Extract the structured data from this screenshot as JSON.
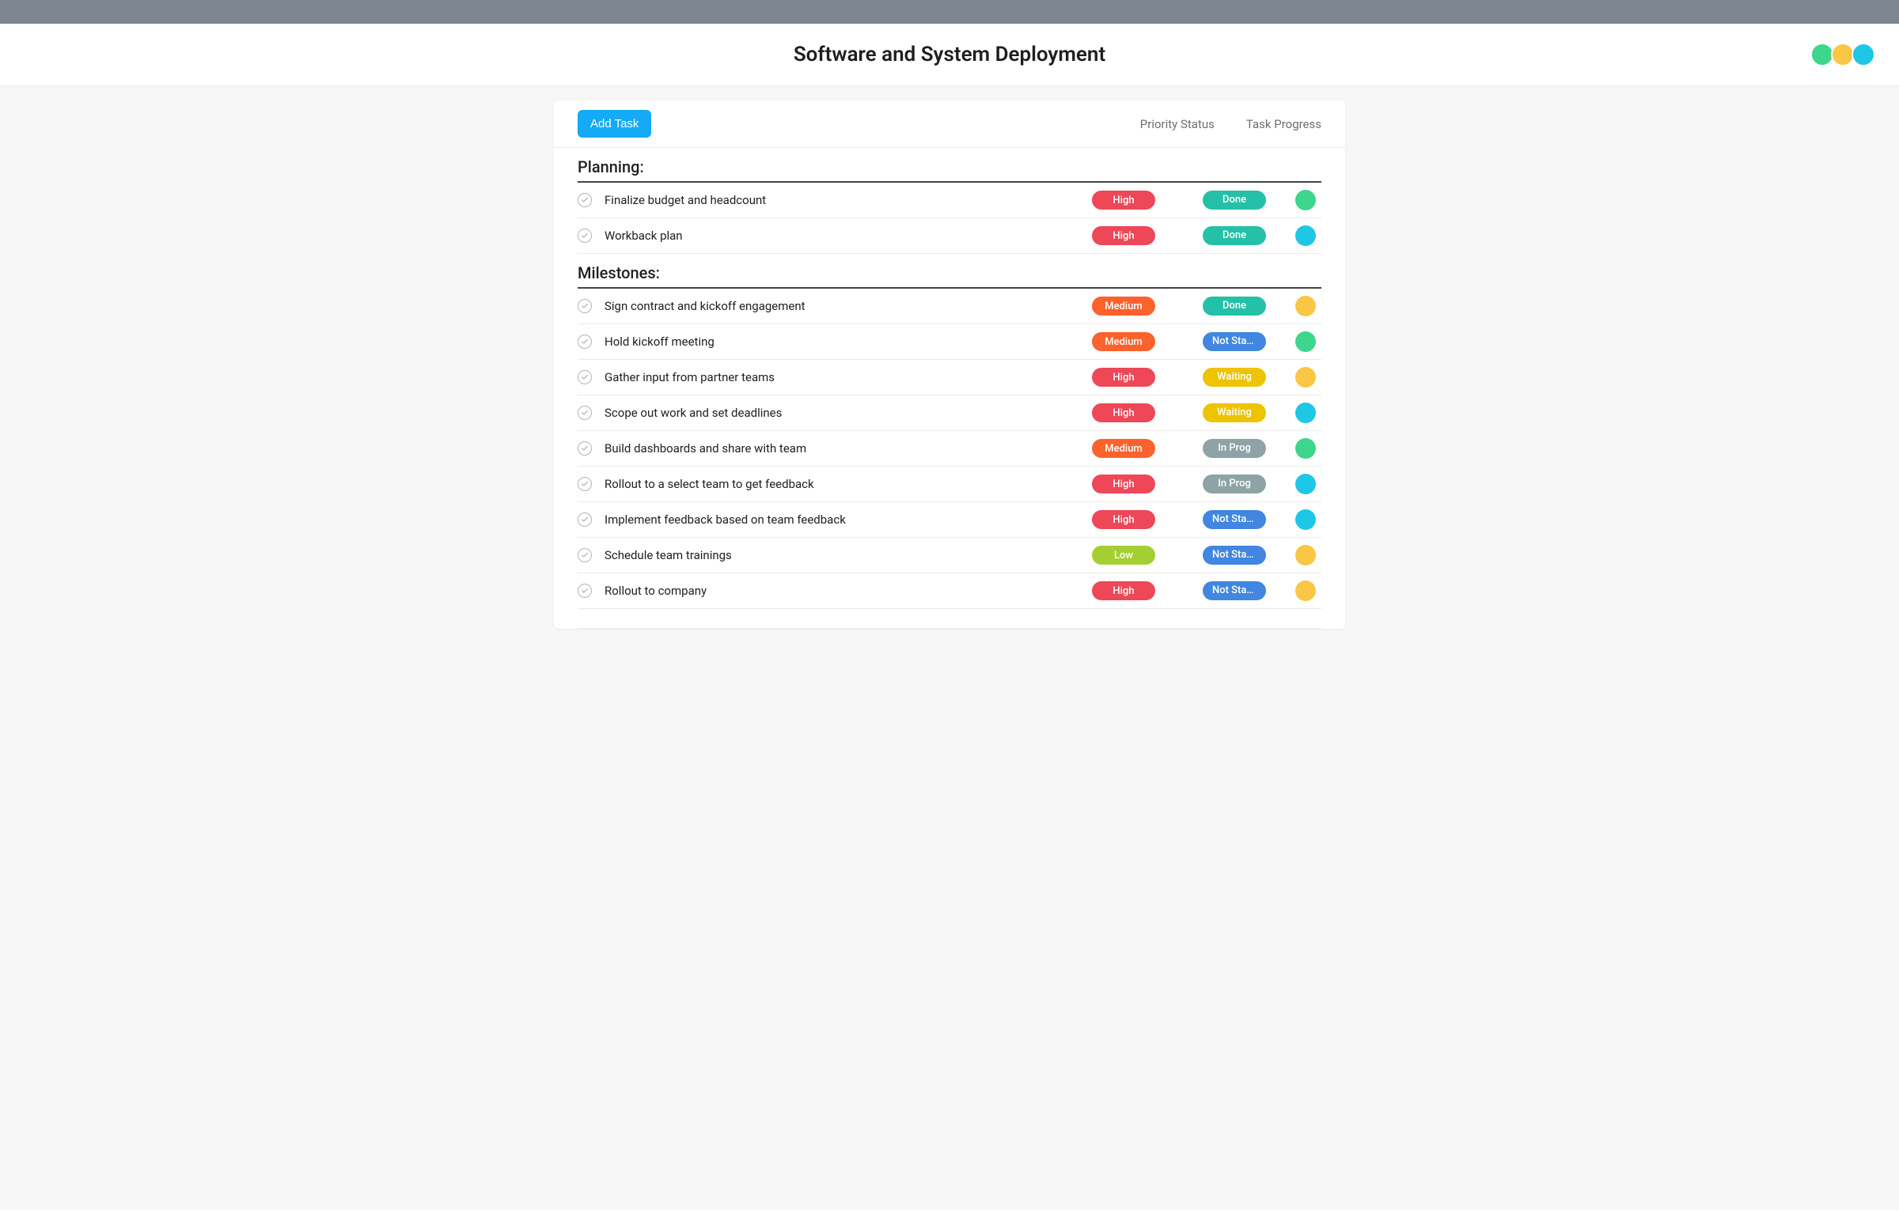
{
  "header": {
    "title": "Software and System Deployment"
  },
  "toolbar": {
    "add_task_label": "Add Task",
    "column_priority": "Priority Status",
    "column_progress": "Task Progress"
  },
  "priority_colors": {
    "High": "#ed4758",
    "Medium": "#fd612c",
    "Low": "#a4cf30"
  },
  "progress_colors": {
    "Done": "#25c0a8",
    "Not Star…": "#4186e0",
    "Waiting": "#eec300",
    "In Prog": "#8da3a6"
  },
  "avatar_colors": {
    "green": "#3dd68c",
    "yellow": "#f9c744",
    "cyan": "#1ec7e6"
  },
  "header_avatars": [
    "green",
    "yellow",
    "cyan"
  ],
  "sections": [
    {
      "title": "Planning:",
      "tasks": [
        {
          "name": "Finalize budget and headcount",
          "priority": "High",
          "progress": "Done",
          "assignee": "green"
        },
        {
          "name": "Workback plan",
          "priority": "High",
          "progress": "Done",
          "assignee": "cyan"
        }
      ]
    },
    {
      "title": "Milestones:",
      "tasks": [
        {
          "name": "Sign contract and kickoff engagement",
          "priority": "Medium",
          "progress": "Done",
          "assignee": "yellow"
        },
        {
          "name": "Hold kickoff meeting",
          "priority": "Medium",
          "progress": "Not Star…",
          "assignee": "green"
        },
        {
          "name": "Gather input from partner teams",
          "priority": "High",
          "progress": "Waiting",
          "assignee": "yellow"
        },
        {
          "name": "Scope out work and set deadlines",
          "priority": "High",
          "progress": "Waiting",
          "assignee": "cyan"
        },
        {
          "name": "Build dashboards and share with team",
          "priority": "Medium",
          "progress": "In Prog",
          "assignee": "green"
        },
        {
          "name": "Rollout to a select team to get feedback",
          "priority": "High",
          "progress": "In Prog",
          "assignee": "cyan"
        },
        {
          "name": "Implement feedback based on team feedback",
          "priority": "High",
          "progress": "Not Star…",
          "assignee": "cyan"
        },
        {
          "name": "Schedule team trainings",
          "priority": "Low",
          "progress": "Not Star…",
          "assignee": "yellow"
        },
        {
          "name": "Rollout to company",
          "priority": "High",
          "progress": "Not Star…",
          "assignee": "yellow"
        }
      ]
    }
  ]
}
